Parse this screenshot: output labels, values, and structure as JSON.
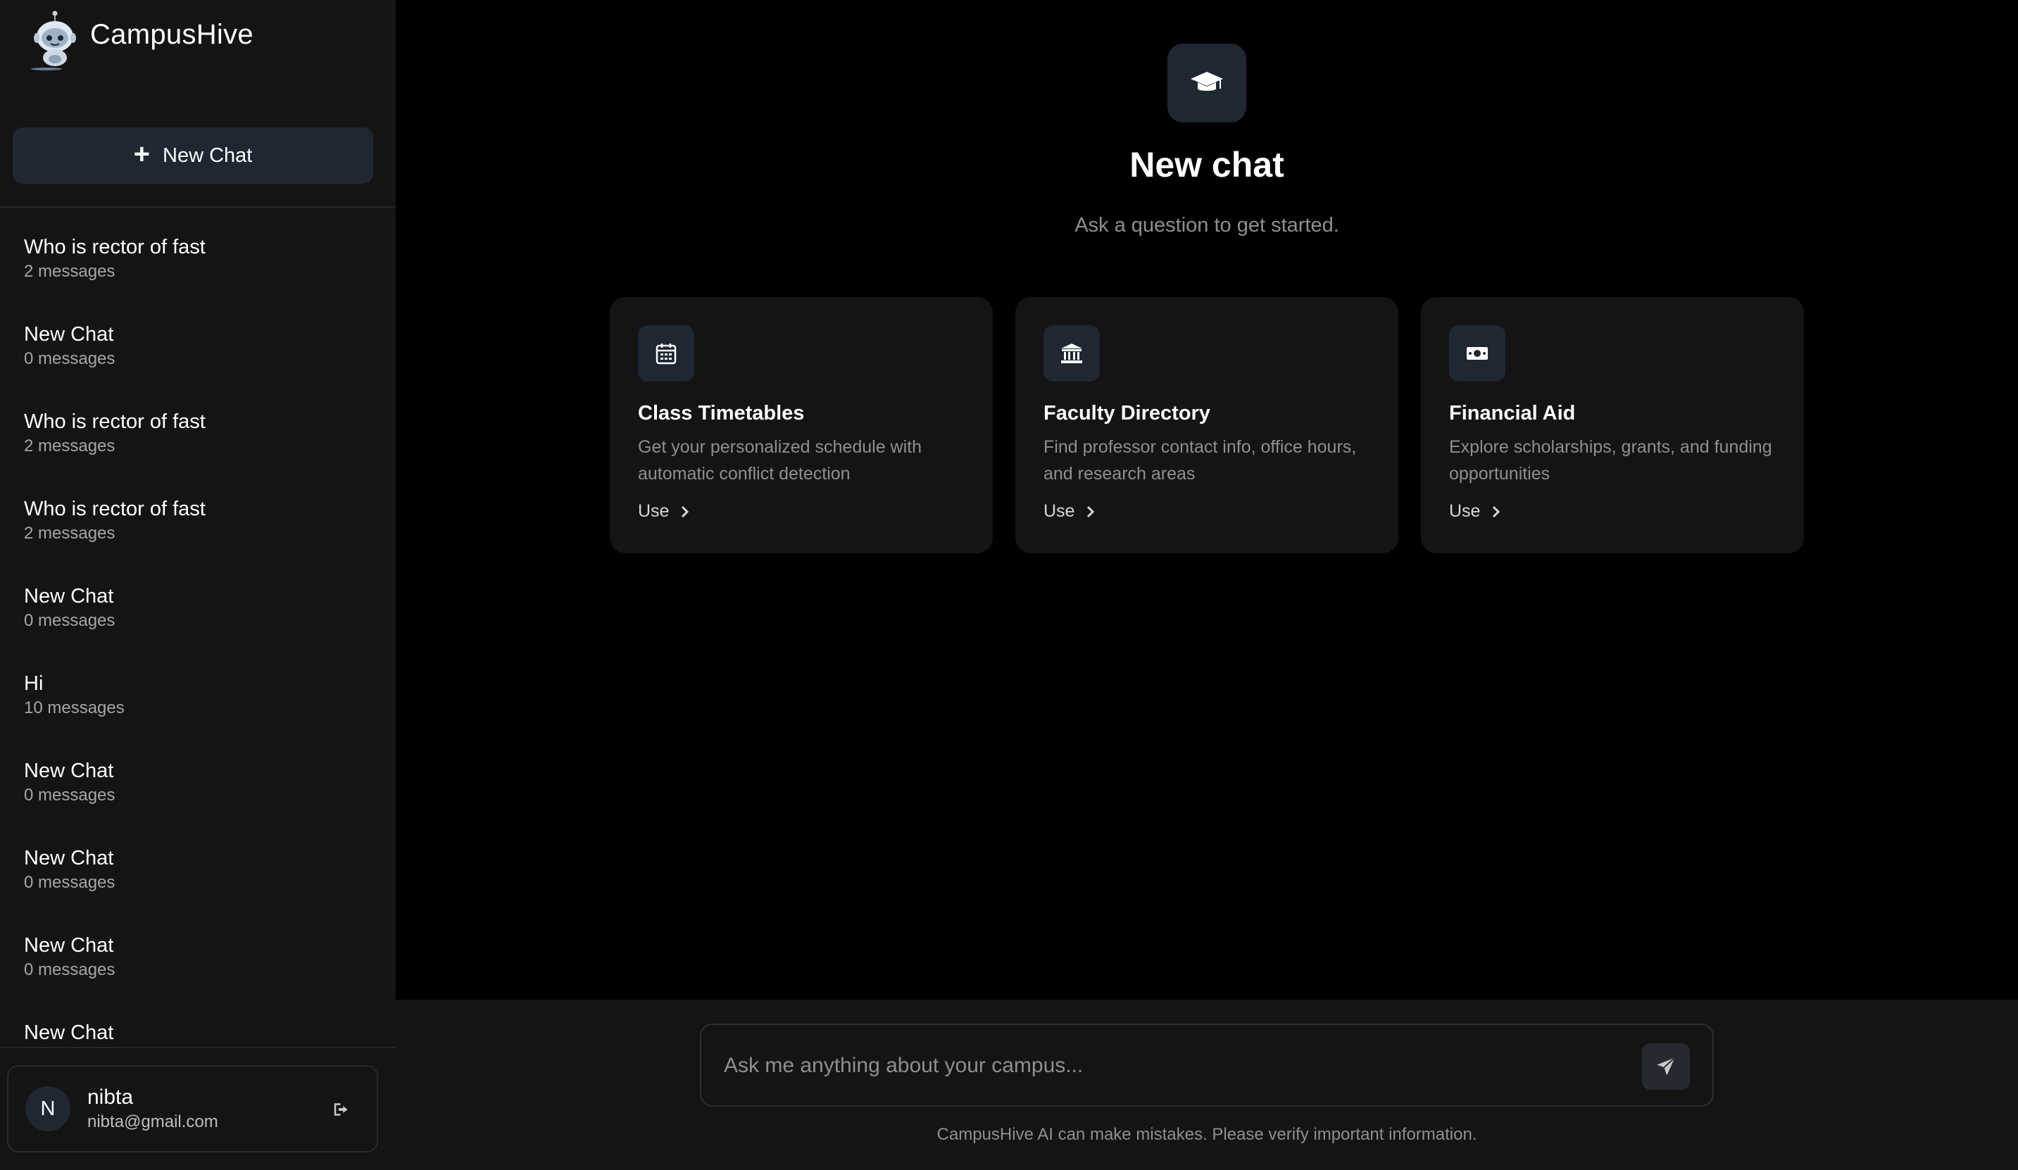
{
  "sidebar": {
    "brand_name": "CampusHive",
    "new_chat_label": "New Chat",
    "chats": [
      {
        "title": "Who is rector of fast",
        "count": "2 messages"
      },
      {
        "title": "New Chat",
        "count": "0 messages"
      },
      {
        "title": "Who is rector of fast",
        "count": "2 messages"
      },
      {
        "title": "Who is rector of fast",
        "count": "2 messages"
      },
      {
        "title": "New Chat",
        "count": "0 messages"
      },
      {
        "title": "Hi",
        "count": "10 messages"
      },
      {
        "title": "New Chat",
        "count": "0 messages"
      },
      {
        "title": "New Chat",
        "count": "0 messages"
      },
      {
        "title": "New Chat",
        "count": "0 messages"
      },
      {
        "title": "New Chat",
        "count": ""
      }
    ],
    "user": {
      "initial": "N",
      "name": "nibta",
      "email": "nibta@gmail.com"
    }
  },
  "main": {
    "title": "New chat",
    "subtitle": "Ask a question to get started.",
    "cards": [
      {
        "icon": "calendar-icon",
        "title": "Class Timetables",
        "desc": "Get your personalized schedule with automatic conflict detection",
        "action": "Use"
      },
      {
        "icon": "bank-icon",
        "title": "Faculty Directory",
        "desc": "Find professor contact info, office hours, and research areas",
        "action": "Use"
      },
      {
        "icon": "money-icon",
        "title": "Financial Aid",
        "desc": "Explore scholarships, grants, and funding opportunities",
        "action": "Use"
      }
    ],
    "input_placeholder": "Ask me anything about your campus...",
    "disclaimer": "CampusHive AI can make mistakes. Please verify important information."
  },
  "colors": {
    "background": "#000000",
    "sidebar": "#141414",
    "accent_surface": "#1f2733",
    "muted_text": "#8f8f8f"
  }
}
